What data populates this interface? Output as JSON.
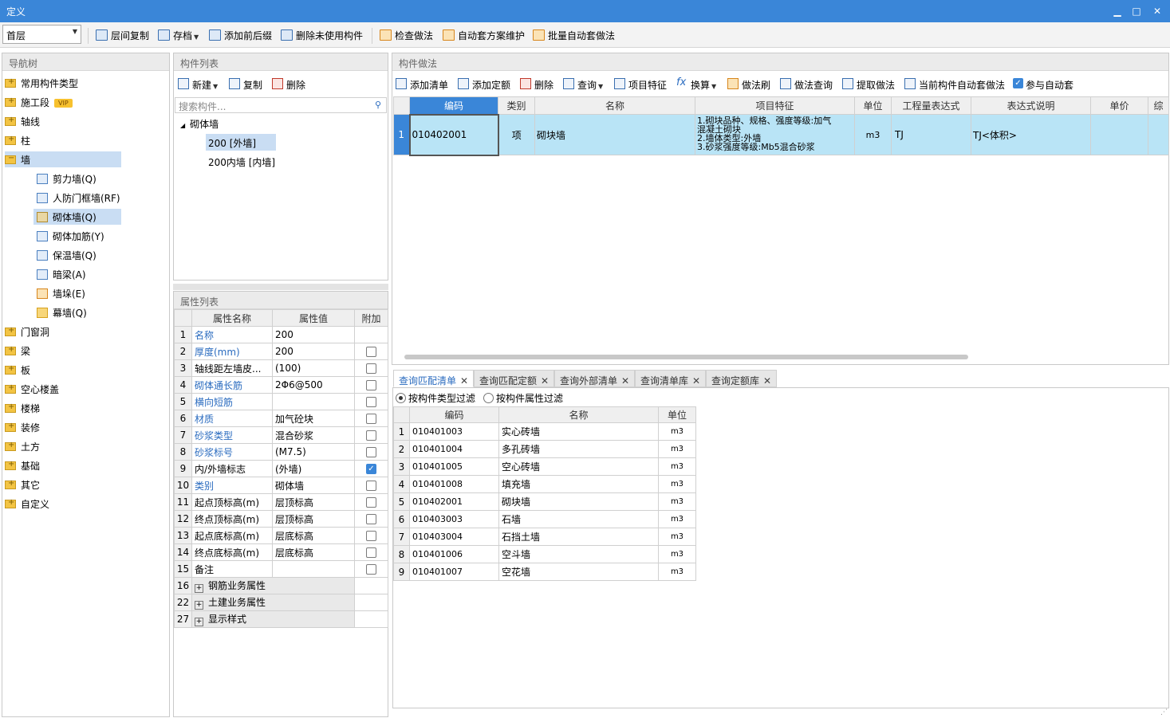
{
  "window": {
    "title": "定义",
    "min": "▁",
    "max": "□",
    "close": "✕"
  },
  "toolbar": {
    "floor": "首层",
    "buttons": [
      "层间复制",
      "存档",
      "添加前后缀",
      "删除未使用构件",
      "检查做法",
      "自动套方案维护",
      "批量自动套做法"
    ]
  },
  "nav": {
    "header": "导航树",
    "items": [
      "常用构件类型",
      "施工段",
      "轴线",
      "柱",
      "墙",
      "门窗洞",
      "梁",
      "板",
      "空心楼盖",
      "楼梯",
      "装修",
      "土方",
      "基础",
      "其它",
      "自定义"
    ],
    "vip": "VIP",
    "wall_children": [
      "剪力墙(Q)",
      "人防门框墙(RF)",
      "砌体墙(Q)",
      "砌体加筋(Y)",
      "保温墙(Q)",
      "暗梁(A)",
      "墙垛(E)",
      "幕墙(Q)"
    ]
  },
  "components": {
    "header": "构件列表",
    "toolbar": [
      "新建",
      "复制",
      "删除"
    ],
    "search_placeholder": "搜索构件...",
    "group": "砌体墙",
    "items": [
      "200 [外墙]",
      "200内墙 [内墙]"
    ]
  },
  "props": {
    "header": "属性列表",
    "columns": [
      "属性名称",
      "属性值",
      "附加"
    ],
    "rows": [
      {
        "n": "1",
        "name": "名称",
        "value": "200",
        "check": null,
        "blue": true
      },
      {
        "n": "2",
        "name": "厚度(mm)",
        "value": "200",
        "check": false,
        "blue": true
      },
      {
        "n": "3",
        "name": "轴线距左墙皮...",
        "value": "(100)",
        "check": false,
        "blue": false
      },
      {
        "n": "4",
        "name": "砌体通长筋",
        "value": "2Φ6@500",
        "check": false,
        "blue": true
      },
      {
        "n": "5",
        "name": "横向短筋",
        "value": "",
        "check": false,
        "blue": true
      },
      {
        "n": "6",
        "name": "材质",
        "value": "加气砼块",
        "check": false,
        "blue": true
      },
      {
        "n": "7",
        "name": "砂浆类型",
        "value": "混合砂浆",
        "check": false,
        "blue": true
      },
      {
        "n": "8",
        "name": "砂浆标号",
        "value": "(M7.5)",
        "check": false,
        "blue": true
      },
      {
        "n": "9",
        "name": "内/外墙标志",
        "value": "(外墙)",
        "check": true,
        "blue": false
      },
      {
        "n": "10",
        "name": "类别",
        "value": "砌体墙",
        "check": false,
        "blue": true
      },
      {
        "n": "11",
        "name": "起点顶标高(m)",
        "value": "层顶标高",
        "check": false,
        "blue": false
      },
      {
        "n": "12",
        "name": "终点顶标高(m)",
        "value": "层顶标高",
        "check": false,
        "blue": false
      },
      {
        "n": "13",
        "name": "起点底标高(m)",
        "value": "层底标高",
        "check": false,
        "blue": false
      },
      {
        "n": "14",
        "name": "终点底标高(m)",
        "value": "层底标高",
        "check": false,
        "blue": false
      },
      {
        "n": "15",
        "name": "备注",
        "value": "",
        "check": false,
        "blue": false
      }
    ],
    "groups": [
      {
        "n": "16",
        "name": "钢筋业务属性"
      },
      {
        "n": "22",
        "name": "土建业务属性"
      },
      {
        "n": "27",
        "name": "显示样式"
      }
    ]
  },
  "methods": {
    "header": "构件做法",
    "toolbar": [
      "添加清单",
      "添加定额",
      "删除",
      "查询",
      "项目特征",
      "换算",
      "做法刷",
      "做法查询",
      "提取做法",
      "当前构件自动套做法",
      "参与自动套"
    ],
    "columns": [
      "编码",
      "类别",
      "名称",
      "项目特征",
      "单位",
      "工程量表达式",
      "表达式说明",
      "单价",
      "综"
    ],
    "row": {
      "n": "1",
      "code": "010402001",
      "type": "项",
      "name": "砌块墙",
      "feature": [
        "1.砌块品种、规格、强度等级:加气",
        "混凝土砌块",
        "2.墙体类型:外墙",
        "3.砂浆强度等级:Mb5混合砂浆"
      ],
      "unit": "m3",
      "expr": "TJ",
      "desc": "TJ<体积>"
    }
  },
  "query": {
    "tabs": [
      "查询匹配清单",
      "查询匹配定额",
      "查询外部清单",
      "查询清单库",
      "查询定额库"
    ],
    "filters": [
      "按构件类型过滤",
      "按构件属性过滤"
    ],
    "columns": [
      "编码",
      "名称",
      "单位"
    ],
    "rows": [
      {
        "n": "1",
        "code": "010401003",
        "name": "实心砖墙",
        "unit": "m3"
      },
      {
        "n": "2",
        "code": "010401004",
        "name": "多孔砖墙",
        "unit": "m3"
      },
      {
        "n": "3",
        "code": "010401005",
        "name": "空心砖墙",
        "unit": "m3"
      },
      {
        "n": "4",
        "code": "010401008",
        "name": "填充墙",
        "unit": "m3"
      },
      {
        "n": "5",
        "code": "010402001",
        "name": "砌块墙",
        "unit": "m3"
      },
      {
        "n": "6",
        "code": "010403003",
        "name": "石墙",
        "unit": "m3"
      },
      {
        "n": "7",
        "code": "010403004",
        "name": "石挡土墙",
        "unit": "m3"
      },
      {
        "n": "8",
        "code": "010401006",
        "name": "空斗墙",
        "unit": "m3"
      },
      {
        "n": "9",
        "code": "010401007",
        "name": "空花墙",
        "unit": "m3"
      }
    ]
  }
}
